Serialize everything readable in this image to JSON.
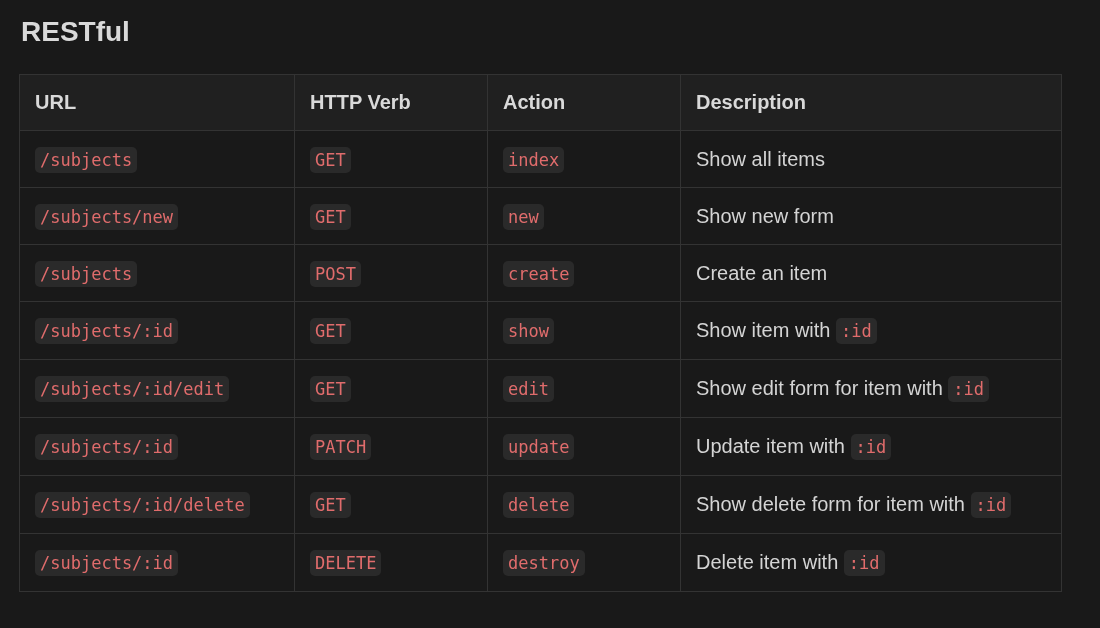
{
  "heading": "RESTful",
  "table": {
    "columns": [
      "URL",
      "HTTP Verb",
      "Action",
      "Description"
    ],
    "rows": [
      {
        "url": "/subjects",
        "verb": "GET",
        "action": "index",
        "description": {
          "text": "Show all items"
        }
      },
      {
        "url": "/subjects/new",
        "verb": "GET",
        "action": "new",
        "description": {
          "text": "Show new form"
        }
      },
      {
        "url": "/subjects",
        "verb": "POST",
        "action": "create",
        "description": {
          "text": "Create an item"
        }
      },
      {
        "url": "/subjects/:id",
        "verb": "GET",
        "action": "show",
        "description": {
          "text": "Show item with",
          "code": ":id"
        }
      },
      {
        "url": "/subjects/:id/edit",
        "verb": "GET",
        "action": "edit",
        "description": {
          "text": "Show edit form for item with",
          "code": ":id"
        }
      },
      {
        "url": "/subjects/:id",
        "verb": "PATCH",
        "action": "update",
        "description": {
          "text": "Update item with",
          "code": ":id"
        }
      },
      {
        "url": "/subjects/:id/delete",
        "verb": "GET",
        "action": "delete",
        "description": {
          "text": "Show delete form for item with",
          "code": ":id"
        }
      },
      {
        "url": "/subjects/:id",
        "verb": "DELETE",
        "action": "destroy",
        "description": {
          "text": "Delete item with",
          "code": ":id"
        }
      }
    ]
  }
}
